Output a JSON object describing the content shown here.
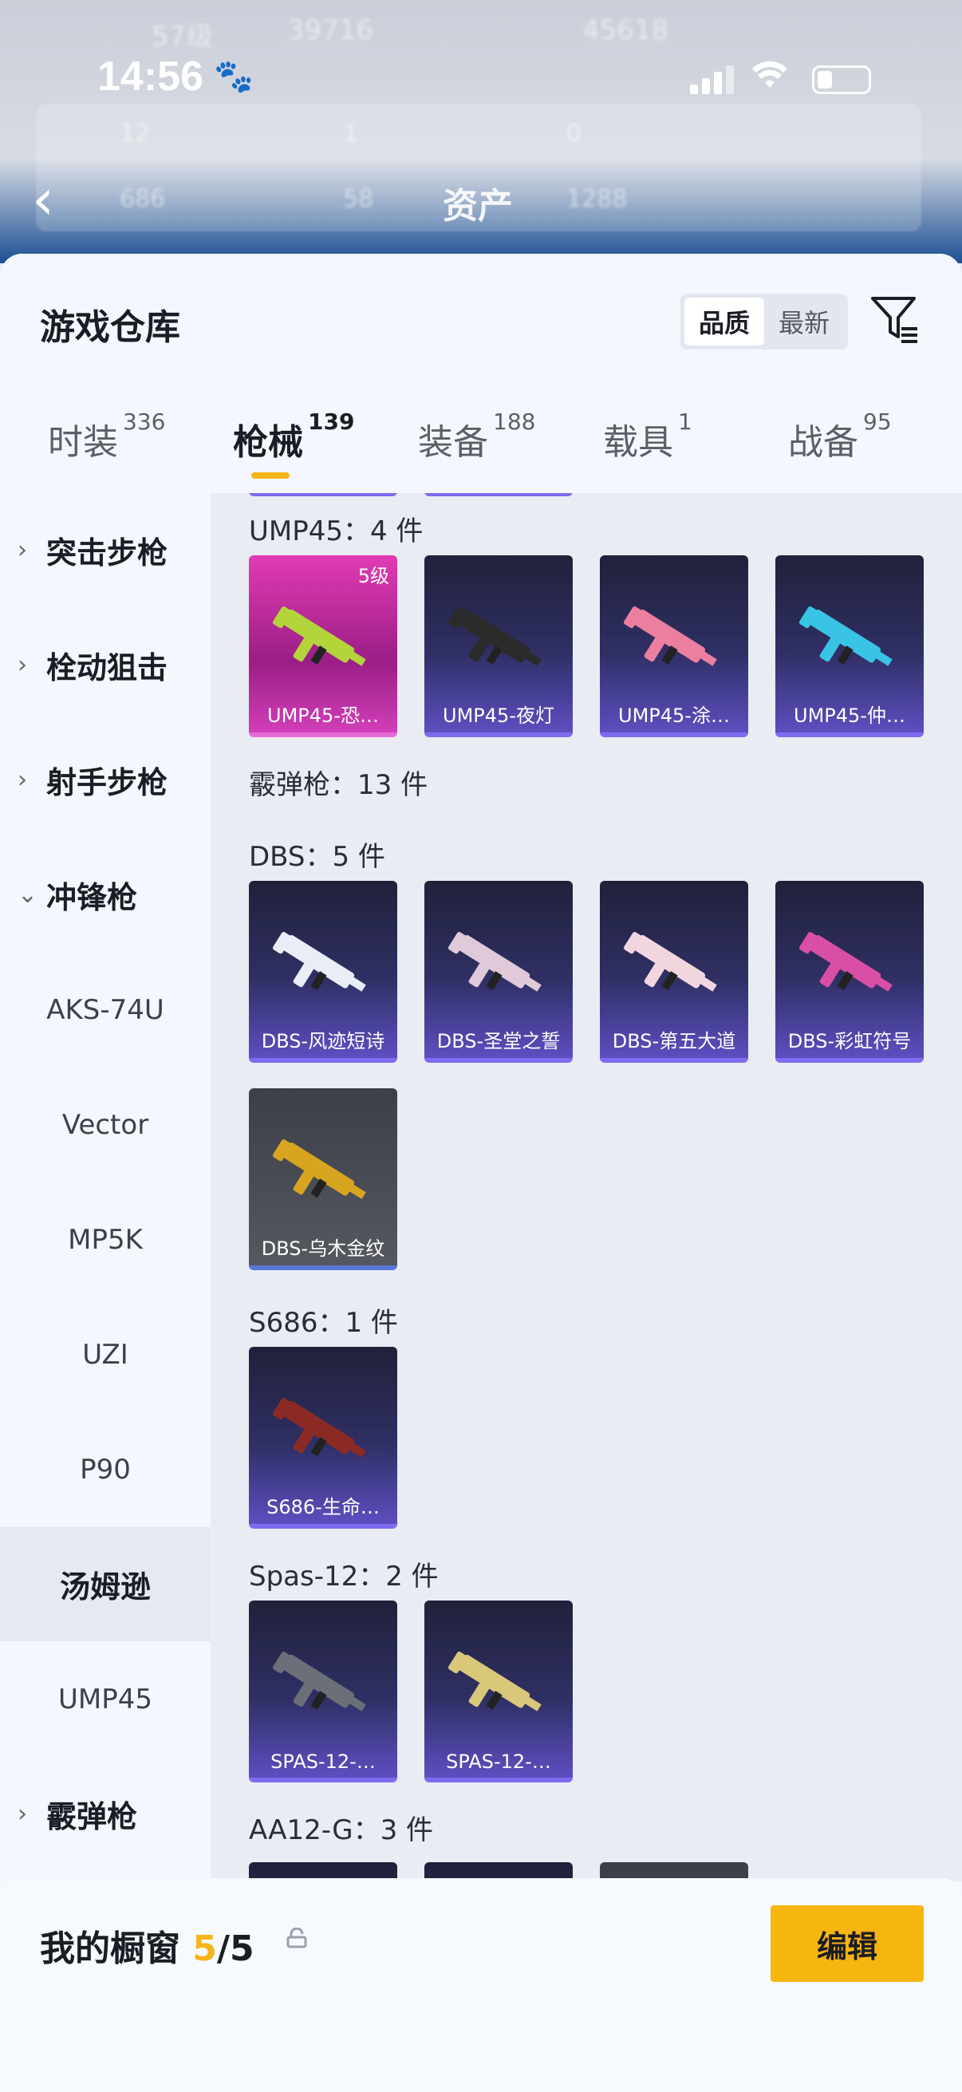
{
  "status": {
    "time": "14:56"
  },
  "background": {
    "title": "资产",
    "blur_row_1": [
      "57级",
      "39716",
      "45618"
    ],
    "blur_row_2": [
      "12",
      "1",
      "0"
    ],
    "blur_row_3": [
      "686",
      "58",
      "1288"
    ]
  },
  "header": {
    "title": "游戏仓库",
    "sort_options": [
      "品质",
      "最新"
    ],
    "sort_selected": "品质"
  },
  "tabs": [
    {
      "label": "时装",
      "count": "336"
    },
    {
      "label": "枪械",
      "count": "139"
    },
    {
      "label": "装备",
      "count": "188"
    },
    {
      "label": "载具",
      "count": "1"
    },
    {
      "label": "战备",
      "count": "95"
    }
  ],
  "sidebar": [
    {
      "label": "突击步枪",
      "type": "category"
    },
    {
      "label": "栓动狙击",
      "type": "category"
    },
    {
      "label": "射手步枪",
      "type": "category"
    },
    {
      "label": "冲锋枪",
      "type": "category-open"
    },
    {
      "label": "AKS-74U",
      "type": "sub"
    },
    {
      "label": "Vector",
      "type": "sub"
    },
    {
      "label": "MP5K",
      "type": "sub"
    },
    {
      "label": "UZI",
      "type": "sub"
    },
    {
      "label": "P90",
      "type": "sub"
    },
    {
      "label": "汤姆逊",
      "type": "selected"
    },
    {
      "label": "UMP45",
      "type": "sub"
    },
    {
      "label": "霰弹枪",
      "type": "category"
    }
  ],
  "sections": {
    "ump45": {
      "title": "UMP45：4 件",
      "items": [
        {
          "label": "UMP45-恐…",
          "level": "5级",
          "style": "pink",
          "color": "#b3d43a"
        },
        {
          "label": "UMP45-夜灯",
          "style": "blue",
          "color": "#2b2b2b"
        },
        {
          "label": "UMP45-涂…",
          "style": "blue",
          "color": "#ec7fa0"
        },
        {
          "label": "UMP45-仲…",
          "style": "blue",
          "color": "#39c3e4"
        }
      ]
    },
    "shotgun": {
      "title": "霰弹枪：13 件"
    },
    "dbs": {
      "title": "DBS：5 件",
      "items": [
        {
          "label": "DBS-风迹短诗",
          "style": "blue",
          "color": "#e9eef6"
        },
        {
          "label": "DBS-圣堂之誓",
          "style": "blue",
          "color": "#e0c9d8"
        },
        {
          "label": "DBS-第五大道",
          "style": "blue",
          "color": "#f2d6df"
        },
        {
          "label": "DBS-彩虹符号",
          "style": "blue",
          "color": "#d94fa6"
        },
        {
          "label": "DBS-乌木金纹",
          "style": "grey",
          "color": "#d8a520"
        }
      ]
    },
    "s686": {
      "title": "S686：1 件",
      "items": [
        {
          "label": "S686-生命…",
          "style": "blue",
          "color": "#8b2a24"
        }
      ]
    },
    "spas": {
      "title": "Spas-12：2 件",
      "items": [
        {
          "label": "SPAS-12-…",
          "style": "blue",
          "color": "#6b6f78"
        },
        {
          "label": "SPAS-12-…",
          "style": "blue",
          "color": "#d9c77a"
        }
      ]
    },
    "aa12": {
      "title": "AA12-G：3 件"
    }
  },
  "bottom": {
    "label": "我的橱窗",
    "used": "5",
    "total": "/5",
    "edit_label": "编辑"
  }
}
